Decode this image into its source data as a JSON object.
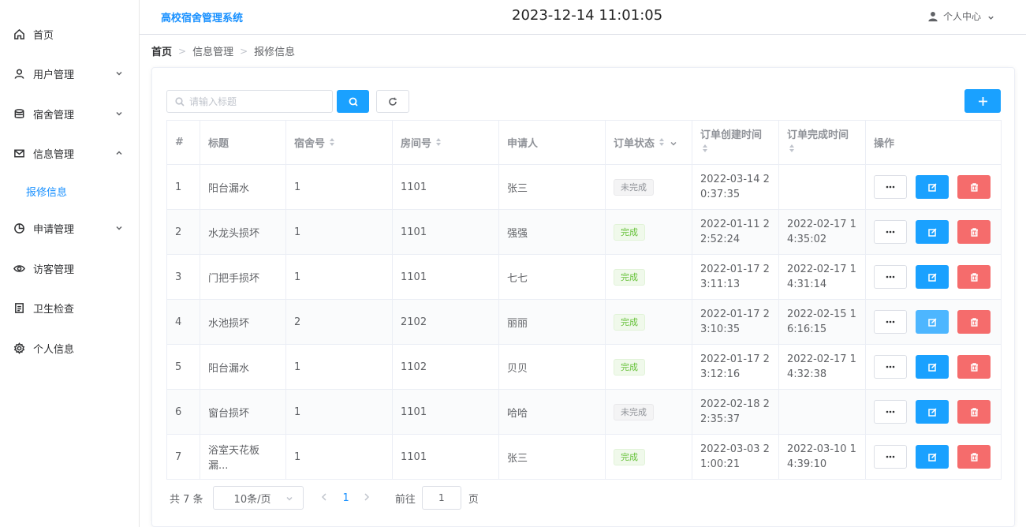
{
  "sidebar": {
    "items": [
      {
        "label": "首页",
        "icon": "home-icon"
      },
      {
        "label": "用户管理",
        "icon": "user-icon"
      },
      {
        "label": "宿舍管理",
        "icon": "database-icon"
      },
      {
        "label": "信息管理",
        "icon": "mail-icon"
      },
      {
        "label": "申请管理",
        "icon": "pie-chart-icon"
      },
      {
        "label": "访客管理",
        "icon": "eye-icon"
      },
      {
        "label": "卫生检查",
        "icon": "document-icon"
      },
      {
        "label": "个人信息",
        "icon": "settings-icon"
      }
    ],
    "submenu": {
      "label": "报修信息"
    }
  },
  "header": {
    "title": "高校宿舍管理系统",
    "datetime": "2023-12-14 11:01:05",
    "user_menu": "个人中心"
  },
  "breadcrumb": [
    "首页",
    "信息管理",
    "报修信息"
  ],
  "search": {
    "placeholder": "请输入标题",
    "value": ""
  },
  "table": {
    "headers": [
      "#",
      "标题",
      "宿舍号",
      "房间号",
      "申请人",
      "订单状态",
      "订单创建时间",
      "订单完成时间",
      "操作"
    ],
    "rows": [
      {
        "idx": "1",
        "title": "阳台漏水",
        "building": "1",
        "room": "1101",
        "applicant": "张三",
        "status": "未完成",
        "status_type": "pending",
        "created": "2022-03-14 20:37:35",
        "finished": ""
      },
      {
        "idx": "2",
        "title": "水龙头损坏",
        "building": "1",
        "room": "1101",
        "applicant": "强强",
        "status": "完成",
        "status_type": "done",
        "created": "2022-01-11 22:52:24",
        "finished": "2022-02-17 14:35:02"
      },
      {
        "idx": "3",
        "title": "门把手损坏",
        "building": "1",
        "room": "1101",
        "applicant": "七七",
        "status": "完成",
        "status_type": "done",
        "created": "2022-01-17 23:11:13",
        "finished": "2022-02-17 14:31:14"
      },
      {
        "idx": "4",
        "title": "水池损坏",
        "building": "2",
        "room": "2102",
        "applicant": "丽丽",
        "status": "完成",
        "status_type": "done",
        "created": "2022-01-17 23:10:35",
        "finished": "2022-02-15 16:16:15"
      },
      {
        "idx": "5",
        "title": "阳台漏水",
        "building": "1",
        "room": "1102",
        "applicant": "贝贝",
        "status": "完成",
        "status_type": "done",
        "created": "2022-01-17 23:12:16",
        "finished": "2022-02-17 14:32:38"
      },
      {
        "idx": "6",
        "title": "窗台损坏",
        "building": "1",
        "room": "1101",
        "applicant": "哈哈",
        "status": "未完成",
        "status_type": "pending",
        "created": "2022-02-18 22:35:37",
        "finished": ""
      },
      {
        "idx": "7",
        "title": "浴室天花板漏...",
        "building": "1",
        "room": "1101",
        "applicant": "张三",
        "status": "完成",
        "status_type": "done",
        "created": "2022-03-03 21:00:21",
        "finished": "2022-03-10 14:39:10"
      }
    ]
  },
  "pagination": {
    "total_text": "共 7 条",
    "page_size": "10条/页",
    "current_page": "1",
    "goto_label": "前往",
    "goto_value": "1",
    "page_unit": "页"
  },
  "colors": {
    "primary": "#1aa1ff",
    "danger": "#f56c6c",
    "success": "#67c23a"
  }
}
